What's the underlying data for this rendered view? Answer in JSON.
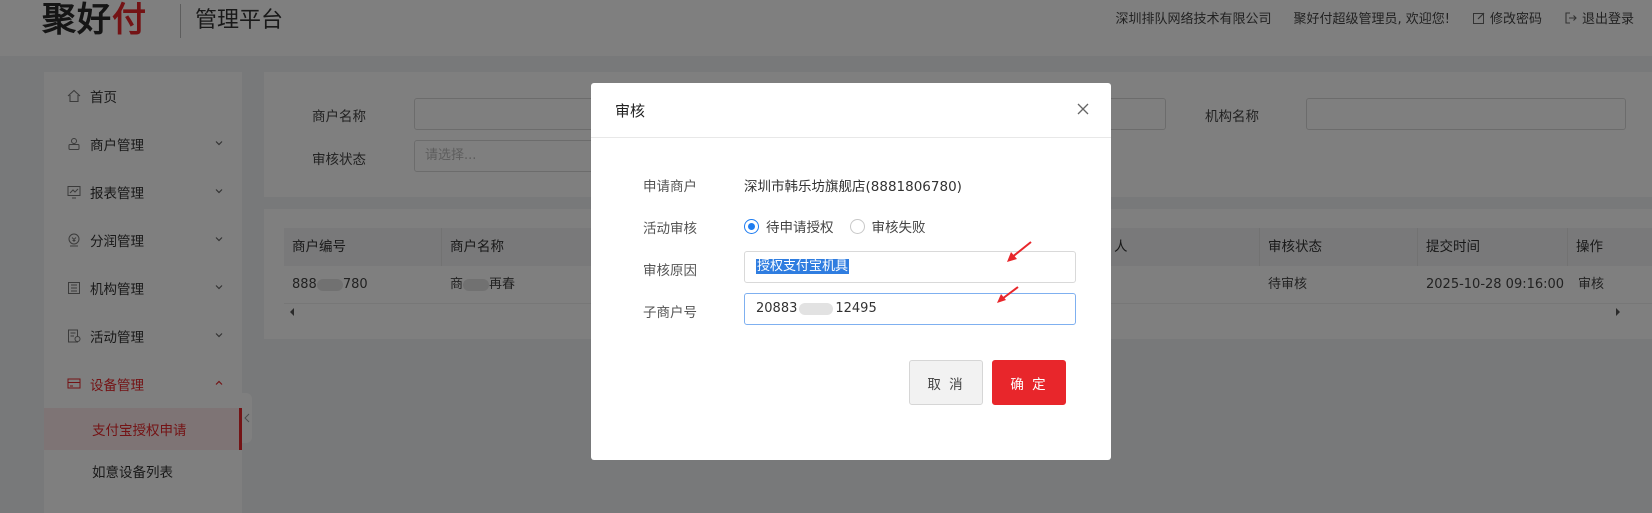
{
  "header": {
    "logo": "聚好付",
    "platform_title": "管理平台",
    "company": "深圳排队网络技术有限公司",
    "welcome": "聚好付超级管理员, 欢迎您!",
    "change_password": "修改密码",
    "logout": "退出登录"
  },
  "sidebar": {
    "items": [
      {
        "label": "首页",
        "icon": "home-icon"
      },
      {
        "label": "商户管理",
        "icon": "merchant-icon"
      },
      {
        "label": "报表管理",
        "icon": "report-icon"
      },
      {
        "label": "分润管理",
        "icon": "profit-icon"
      },
      {
        "label": "机构管理",
        "icon": "org-icon"
      },
      {
        "label": "活动管理",
        "icon": "activity-icon"
      },
      {
        "label": "设备管理",
        "icon": "device-icon"
      }
    ],
    "sub_items": [
      {
        "label": "支付宝授权申请"
      },
      {
        "label": "如意设备列表"
      }
    ]
  },
  "search": {
    "merchant_name_label": "商户名称",
    "org_name_label": "机构名称",
    "audit_status_label": "审核状态",
    "audit_status_placeholder": "请选择..."
  },
  "table": {
    "columns": [
      "商户编号",
      "商户名称",
      "人",
      "审核状态",
      "提交时间",
      "操作"
    ],
    "rows": [
      {
        "merchant_no_prefix": "888",
        "merchant_no_suffix": "780",
        "merchant_name_prefix": "商",
        "merchant_name_suffix": "再春",
        "status": "待审核",
        "submit_time": "2025-10-28 09:16:00",
        "action": "审核"
      }
    ]
  },
  "modal": {
    "title": "审核",
    "applicant_label": "申请商户",
    "applicant_value": "深圳市韩乐坊旗舰店(8881806780)",
    "activity_audit_label": "活动审核",
    "radio_options": [
      "待申请授权",
      "审核失败"
    ],
    "selected_option": "待申请授权",
    "reason_label": "审核原因",
    "reason_value": "授权支付宝机具",
    "sub_merchant_label": "子商户号",
    "sub_merchant_prefix": "20883",
    "sub_merchant_suffix": "12495",
    "cancel_label": "取 消",
    "confirm_label": "确 定"
  },
  "colors": {
    "brand_red": "#e8262b",
    "primary_blue": "#1e7cf0"
  }
}
